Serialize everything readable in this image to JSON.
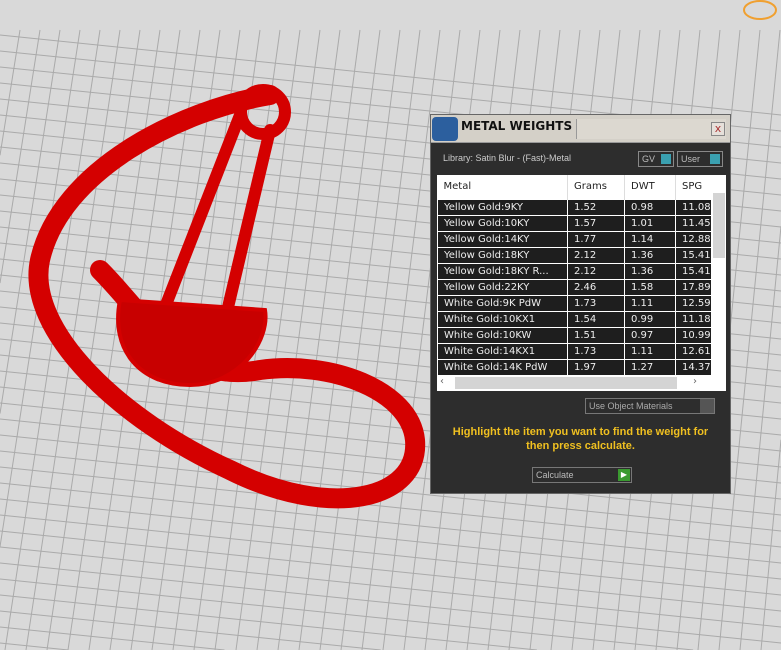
{
  "panel": {
    "title": "METAL WEIGHTS",
    "close": "x",
    "library": "Library: Satin Blur - (Fast)-Metal",
    "gv_label": "GV",
    "user_label": "User",
    "columns": [
      "Metal",
      "Grams",
      "DWT",
      "SPG"
    ],
    "rows": [
      [
        "Yellow Gold:9KY",
        "1.52",
        "0.98",
        "11.08"
      ],
      [
        "Yellow Gold:10KY",
        "1.57",
        "1.01",
        "11.45"
      ],
      [
        "Yellow Gold:14KY",
        "1.77",
        "1.14",
        "12.88"
      ],
      [
        "Yellow Gold:18KY",
        "2.12",
        "1.36",
        "15.41"
      ],
      [
        "Yellow Gold:18KY R...",
        "2.12",
        "1.36",
        "15.41"
      ],
      [
        "Yellow Gold:22KY",
        "2.46",
        "1.58",
        "17.89"
      ],
      [
        "White Gold:9K PdW",
        "1.73",
        "1.11",
        "12.59"
      ],
      [
        "White Gold:10KX1",
        "1.54",
        "0.99",
        "11.18"
      ],
      [
        "White Gold:10KW",
        "1.51",
        "0.97",
        "10.99"
      ],
      [
        "White Gold:14KX1",
        "1.73",
        "1.11",
        "12.61"
      ],
      [
        "White Gold:14K PdW",
        "1.97",
        "1.27",
        "14.37"
      ]
    ],
    "use_object_materials": "Use Object Materials",
    "message": "Highlight the item you want to find the weight for then press calculate.",
    "calculate": "Calculate"
  }
}
